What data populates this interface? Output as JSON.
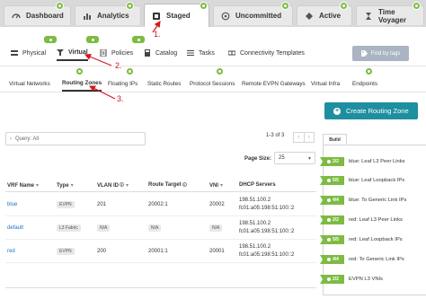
{
  "top_tabs": [
    {
      "label": "Dashboard",
      "icon": "dashboard-icon"
    },
    {
      "label": "Analytics",
      "icon": "analytics-icon"
    },
    {
      "label": "Staged",
      "icon": "staged-icon",
      "active": true
    },
    {
      "label": "Uncommitted",
      "icon": "uncommitted-icon"
    },
    {
      "label": "Active",
      "icon": "active-icon"
    },
    {
      "label": "Time Voyager",
      "icon": "time-voyager-icon"
    }
  ],
  "sub_nav": [
    {
      "label": "Physical",
      "icon": "physical-icon"
    },
    {
      "label": "Virtual",
      "icon": "virtual-icon",
      "active": true
    },
    {
      "label": "Policies",
      "icon": "policies-icon"
    },
    {
      "label": "Catalog",
      "icon": "catalog-icon"
    },
    {
      "label": "Tasks",
      "icon": "tasks-icon"
    },
    {
      "label": "Connectivity Templates",
      "icon": "connectivity-icon"
    }
  ],
  "find_by_tags": "Find by tags",
  "virtual_nav": [
    {
      "label": "Virtual Networks"
    },
    {
      "label": "Routing Zones",
      "active": true
    },
    {
      "label": "Floating IPs"
    },
    {
      "label": "Static Routes"
    },
    {
      "label": "Protocol Sessions"
    },
    {
      "label": "Remote EVPN Gateways"
    },
    {
      "label": "Virtual Infra"
    },
    {
      "label": "Endpoints"
    }
  ],
  "create_button": "Create Routing Zone",
  "query": "Query: All",
  "pager": {
    "range": "1-3 of 3",
    "page_size_label": "Page Size:",
    "page_size": "25"
  },
  "table": {
    "headers": [
      "VRF Name",
      "Type",
      "VLAN ID",
      "Route Target",
      "VNI",
      "DHCP Servers"
    ],
    "rows": [
      {
        "name": "blue",
        "type": "EVPN",
        "vlan": "201",
        "rt": "20002:1",
        "vni": "20002",
        "dhcp1": "198.51.100.2",
        "dhcp2": "fc01:a05:198:51:100::2"
      },
      {
        "name": "default",
        "type": "L3 Fabric",
        "vlan": "N/A",
        "rt": "N/A",
        "vni": "N/A",
        "dhcp1": "198.51.100.2",
        "dhcp2": "fc01:a05:198:51:100::2"
      },
      {
        "name": "red",
        "type": "EVPN",
        "vlan": "200",
        "rt": "20001:1",
        "vni": "20001",
        "dhcp1": "198.51.100.2",
        "dhcp2": "fc01:a05:198:51:100::2"
      }
    ]
  },
  "build_panel": {
    "tab": "Build",
    "items": [
      {
        "badge": "2/2",
        "label": "blue: Leaf L3 Peer Links"
      },
      {
        "badge": "5/5",
        "label": "blue: Leaf Loopback IPs"
      },
      {
        "badge": "4/4",
        "label": "blue: To Generic Link IPs"
      },
      {
        "badge": "2/2",
        "label": "red: Leaf L3 Peer Links"
      },
      {
        "badge": "5/5",
        "label": "red: Leaf Loopback IPs"
      },
      {
        "badge": "4/4",
        "label": "red: To Generic Link IPs"
      },
      {
        "badge": "2/2",
        "label": "EVPN L3 VNIs"
      }
    ]
  },
  "annotations": [
    "1.",
    "2.",
    "3."
  ],
  "colors": {
    "accent": "#1e8fa0",
    "badge_green": "#7dbb42",
    "annotation_red": "#d4181f",
    "link_blue": "#1a73c7"
  }
}
